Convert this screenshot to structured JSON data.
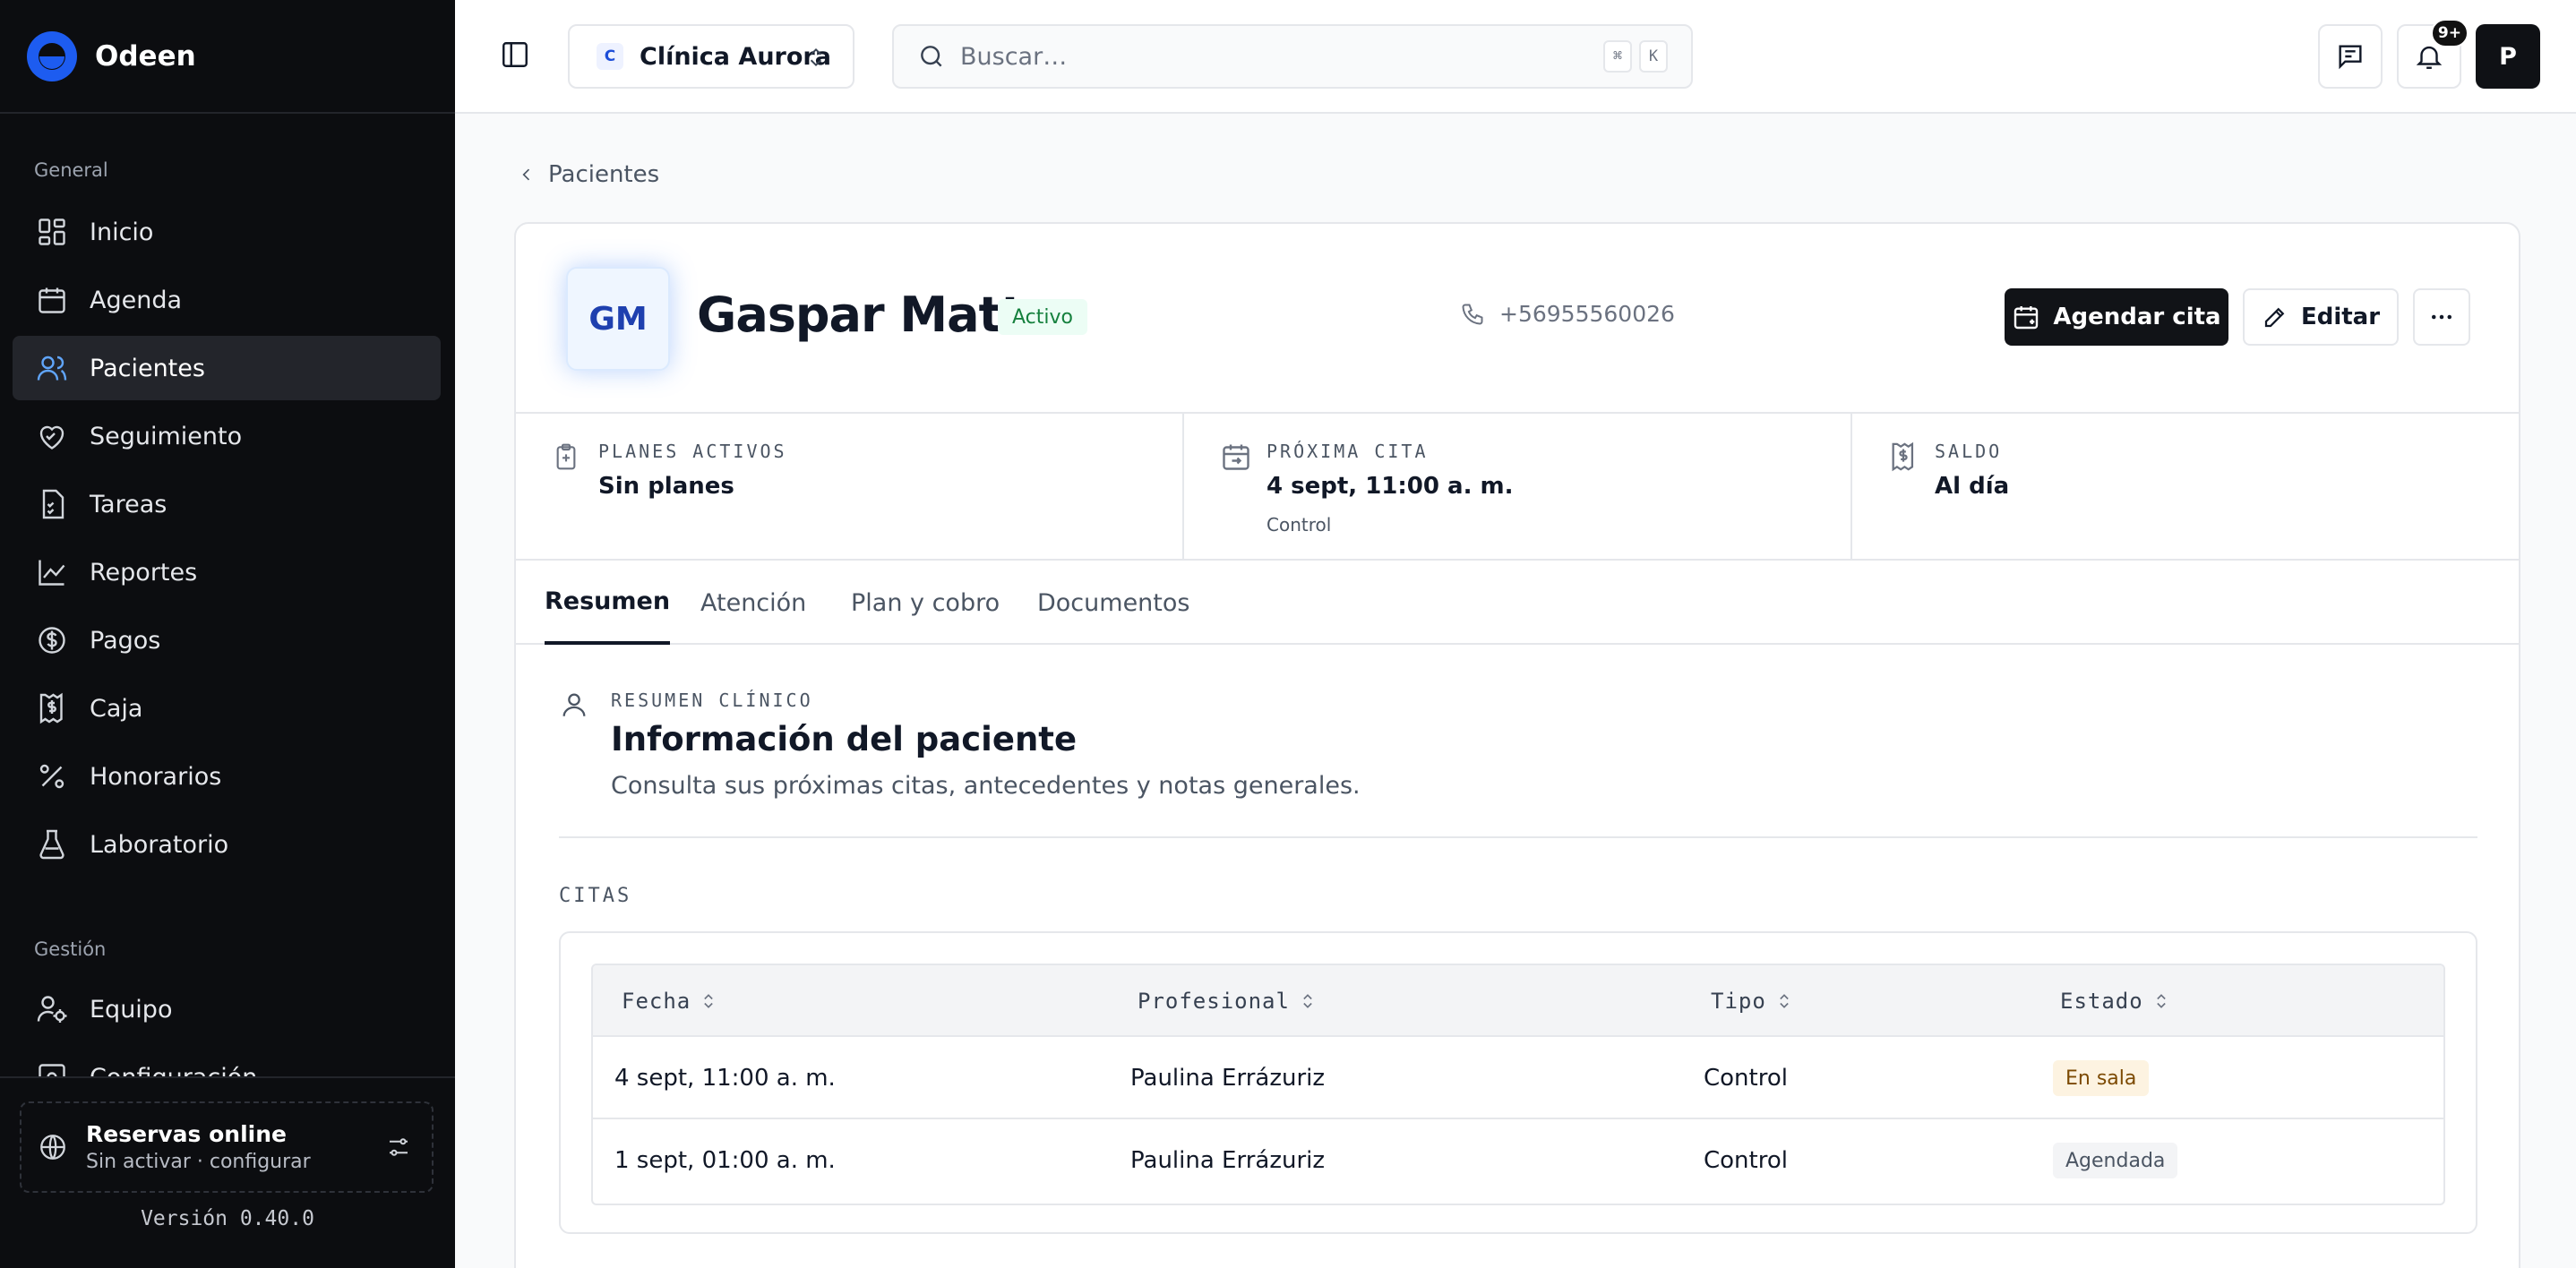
{
  "brand": {
    "name": "Odeen"
  },
  "sidebar": {
    "section_general": "General",
    "items": [
      {
        "label": "Inicio",
        "icon": "dashboard-icon"
      },
      {
        "label": "Agenda",
        "icon": "calendar-icon"
      },
      {
        "label": "Pacientes",
        "icon": "users-icon",
        "active": true
      },
      {
        "label": "Seguimiento",
        "icon": "heart-icon"
      },
      {
        "label": "Tareas",
        "icon": "checklist-icon"
      },
      {
        "label": "Reportes",
        "icon": "chart-icon"
      },
      {
        "label": "Pagos",
        "icon": "dollar-icon"
      },
      {
        "label": "Caja",
        "icon": "cash-register-icon"
      },
      {
        "label": "Honorarios",
        "icon": "percent-icon"
      },
      {
        "label": "Laboratorio",
        "icon": "flask-icon"
      }
    ],
    "section_gestion": "Gestión",
    "gestion_items": [
      {
        "label": "Equipo",
        "icon": "user-cog-icon"
      },
      {
        "label": "Configuración",
        "icon": "settings-icon"
      }
    ],
    "booking": {
      "title": "Reservas online",
      "subtitle": "Sin activar · configurar"
    },
    "version": "Versión 0.40.0"
  },
  "topbar": {
    "clinic_badge": "C",
    "clinic_name": "Clínica Aurora",
    "search_placeholder": "Buscar…",
    "shortcut_key1": "⌘",
    "shortcut_key2": "K",
    "notifications_count": "9+",
    "user_initial": "P"
  },
  "breadcrumb": {
    "back_label": "Pacientes"
  },
  "patient": {
    "initials": "GM",
    "name": "Gaspar Matte",
    "status": "Activo",
    "phone": "+56955560026",
    "schedule_button": "Agendar cita",
    "edit_button": "Editar"
  },
  "stats": [
    {
      "label": "PLANES ACTIVOS",
      "value": "Sin planes",
      "sub": ""
    },
    {
      "label": "PRÓXIMA CITA",
      "value": "4 sept, 11:00 a. m.",
      "sub": "Control"
    },
    {
      "label": "SALDO",
      "value": "Al día",
      "sub": ""
    }
  ],
  "tabs": [
    "Resumen",
    "Atención",
    "Plan y cobro",
    "Documentos"
  ],
  "summary": {
    "label": "RESUMEN CLÍNICO",
    "title": "Información del paciente",
    "description": "Consulta sus próximas citas, antecedentes y notas generales."
  },
  "citas": {
    "label": "CITAS",
    "columns": [
      "Fecha",
      "Profesional",
      "Tipo",
      "Estado"
    ],
    "rows": [
      {
        "fecha": "4 sept, 11:00 a. m.",
        "profesional": "Paulina Errázuriz",
        "tipo": "Control",
        "estado": "En sala"
      },
      {
        "fecha": "1 sept, 01:00 a. m.",
        "profesional": "Paulina Errázuriz",
        "tipo": "Control",
        "estado": "Agendada"
      }
    ]
  }
}
